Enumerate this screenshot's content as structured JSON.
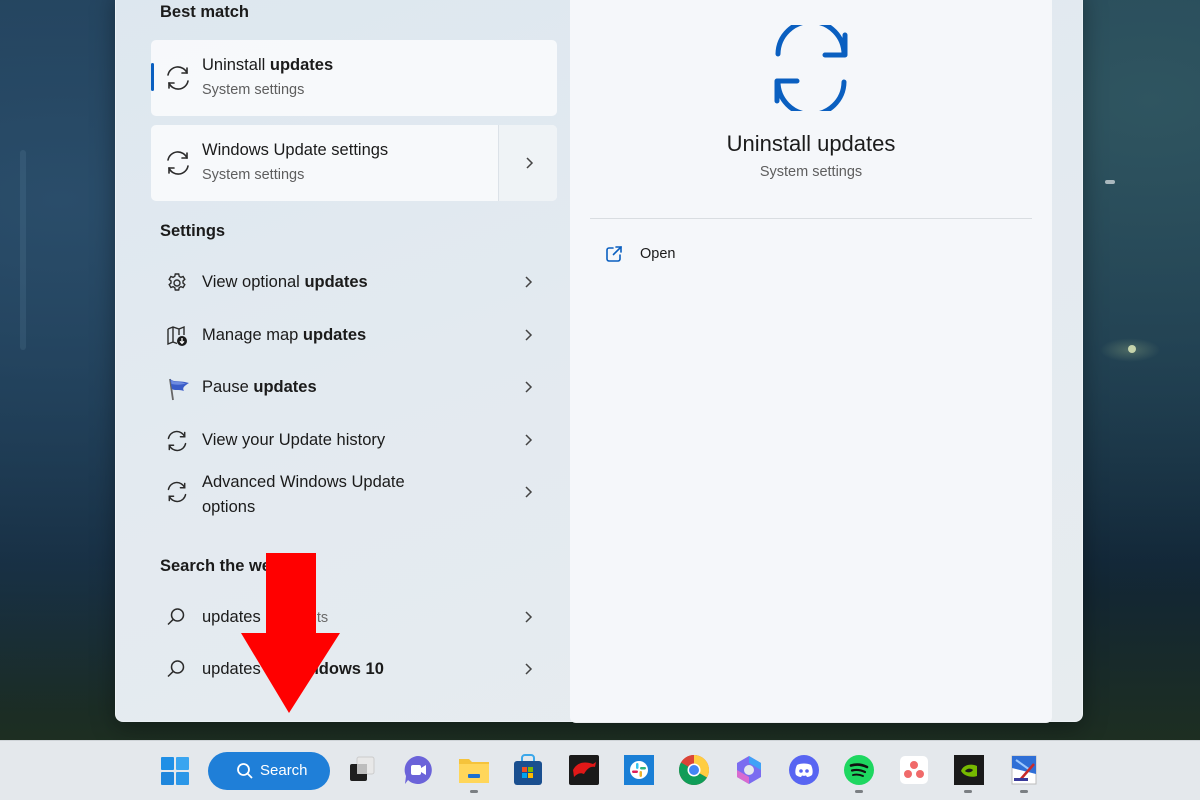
{
  "search_panel": {
    "best_match": {
      "heading": "Best match",
      "items": [
        {
          "title_plain": "Uninstall ",
          "title_bold": "updates",
          "subtitle": "System settings",
          "icon": "sync-icon",
          "selected": true
        },
        {
          "title_plain": "Windows Update settings",
          "title_bold": "",
          "subtitle": "System settings",
          "icon": "sync-icon",
          "selected": false
        }
      ]
    },
    "settings": {
      "heading": "Settings",
      "items": [
        {
          "label_plain": "View optional ",
          "label_bold": "updates",
          "icon": "gear-icon"
        },
        {
          "label_plain": "Manage map ",
          "label_bold": "updates",
          "icon": "map-download-icon"
        },
        {
          "label_plain": "Pause ",
          "label_bold": "updates",
          "icon": "blue-flag-icon"
        },
        {
          "label_plain": "View your Update history",
          "label_bold": "",
          "icon": "sync-icon"
        },
        {
          "label_line1": "Advanced Windows Update",
          "label_line2": "options",
          "icon": "sync-icon"
        }
      ]
    },
    "search_web": {
      "heading": "Search the we",
      "items": [
        {
          "label_bold": "updates",
          "label_muted": "eb results",
          "icon": "search-icon"
        },
        {
          "label_plain": "updates",
          "label_bold": "ndows 10",
          "icon": "search-icon"
        }
      ]
    },
    "preview": {
      "title": "Uninstall updates",
      "subtitle": "System settings",
      "icon": "sync-icon",
      "accent": "#0a5fc0",
      "actions": [
        {
          "label": "Open",
          "icon": "open-external-icon"
        }
      ]
    }
  },
  "annotation": {
    "type": "arrow-down",
    "color": "#ff0000"
  },
  "taskbar": {
    "start_icon": "windows-start-icon",
    "search_label": "Search",
    "apps": [
      {
        "name": "task-view",
        "running": false
      },
      {
        "name": "teams-meet",
        "running": false
      },
      {
        "name": "file-explorer",
        "running": true
      },
      {
        "name": "microsoft-store",
        "running": false
      },
      {
        "name": "msi-dragon-center",
        "running": false
      },
      {
        "name": "slack",
        "running": false
      },
      {
        "name": "chrome",
        "running": false
      },
      {
        "name": "microsoft-365-copilot",
        "running": false
      },
      {
        "name": "discord",
        "running": false
      },
      {
        "name": "spotify",
        "running": true
      },
      {
        "name": "asana",
        "running": false
      },
      {
        "name": "nvidia",
        "running": true
      },
      {
        "name": "paint-tool",
        "running": true
      }
    ]
  }
}
